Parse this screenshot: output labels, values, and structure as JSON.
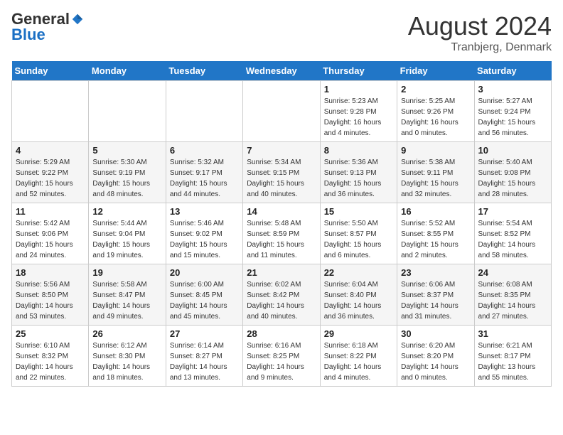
{
  "header": {
    "logo_general": "General",
    "logo_blue": "Blue",
    "month_year": "August 2024",
    "location": "Tranbjerg, Denmark"
  },
  "days_of_week": [
    "Sunday",
    "Monday",
    "Tuesday",
    "Wednesday",
    "Thursday",
    "Friday",
    "Saturday"
  ],
  "weeks": [
    [
      {
        "day": "",
        "info": ""
      },
      {
        "day": "",
        "info": ""
      },
      {
        "day": "",
        "info": ""
      },
      {
        "day": "",
        "info": ""
      },
      {
        "day": "1",
        "info": "Sunrise: 5:23 AM\nSunset: 9:28 PM\nDaylight: 16 hours\nand 4 minutes."
      },
      {
        "day": "2",
        "info": "Sunrise: 5:25 AM\nSunset: 9:26 PM\nDaylight: 16 hours\nand 0 minutes."
      },
      {
        "day": "3",
        "info": "Sunrise: 5:27 AM\nSunset: 9:24 PM\nDaylight: 15 hours\nand 56 minutes."
      }
    ],
    [
      {
        "day": "4",
        "info": "Sunrise: 5:29 AM\nSunset: 9:22 PM\nDaylight: 15 hours\nand 52 minutes."
      },
      {
        "day": "5",
        "info": "Sunrise: 5:30 AM\nSunset: 9:19 PM\nDaylight: 15 hours\nand 48 minutes."
      },
      {
        "day": "6",
        "info": "Sunrise: 5:32 AM\nSunset: 9:17 PM\nDaylight: 15 hours\nand 44 minutes."
      },
      {
        "day": "7",
        "info": "Sunrise: 5:34 AM\nSunset: 9:15 PM\nDaylight: 15 hours\nand 40 minutes."
      },
      {
        "day": "8",
        "info": "Sunrise: 5:36 AM\nSunset: 9:13 PM\nDaylight: 15 hours\nand 36 minutes."
      },
      {
        "day": "9",
        "info": "Sunrise: 5:38 AM\nSunset: 9:11 PM\nDaylight: 15 hours\nand 32 minutes."
      },
      {
        "day": "10",
        "info": "Sunrise: 5:40 AM\nSunset: 9:08 PM\nDaylight: 15 hours\nand 28 minutes."
      }
    ],
    [
      {
        "day": "11",
        "info": "Sunrise: 5:42 AM\nSunset: 9:06 PM\nDaylight: 15 hours\nand 24 minutes."
      },
      {
        "day": "12",
        "info": "Sunrise: 5:44 AM\nSunset: 9:04 PM\nDaylight: 15 hours\nand 19 minutes."
      },
      {
        "day": "13",
        "info": "Sunrise: 5:46 AM\nSunset: 9:02 PM\nDaylight: 15 hours\nand 15 minutes."
      },
      {
        "day": "14",
        "info": "Sunrise: 5:48 AM\nSunset: 8:59 PM\nDaylight: 15 hours\nand 11 minutes."
      },
      {
        "day": "15",
        "info": "Sunrise: 5:50 AM\nSunset: 8:57 PM\nDaylight: 15 hours\nand 6 minutes."
      },
      {
        "day": "16",
        "info": "Sunrise: 5:52 AM\nSunset: 8:55 PM\nDaylight: 15 hours\nand 2 minutes."
      },
      {
        "day": "17",
        "info": "Sunrise: 5:54 AM\nSunset: 8:52 PM\nDaylight: 14 hours\nand 58 minutes."
      }
    ],
    [
      {
        "day": "18",
        "info": "Sunrise: 5:56 AM\nSunset: 8:50 PM\nDaylight: 14 hours\nand 53 minutes."
      },
      {
        "day": "19",
        "info": "Sunrise: 5:58 AM\nSunset: 8:47 PM\nDaylight: 14 hours\nand 49 minutes."
      },
      {
        "day": "20",
        "info": "Sunrise: 6:00 AM\nSunset: 8:45 PM\nDaylight: 14 hours\nand 45 minutes."
      },
      {
        "day": "21",
        "info": "Sunrise: 6:02 AM\nSunset: 8:42 PM\nDaylight: 14 hours\nand 40 minutes."
      },
      {
        "day": "22",
        "info": "Sunrise: 6:04 AM\nSunset: 8:40 PM\nDaylight: 14 hours\nand 36 minutes."
      },
      {
        "day": "23",
        "info": "Sunrise: 6:06 AM\nSunset: 8:37 PM\nDaylight: 14 hours\nand 31 minutes."
      },
      {
        "day": "24",
        "info": "Sunrise: 6:08 AM\nSunset: 8:35 PM\nDaylight: 14 hours\nand 27 minutes."
      }
    ],
    [
      {
        "day": "25",
        "info": "Sunrise: 6:10 AM\nSunset: 8:32 PM\nDaylight: 14 hours\nand 22 minutes."
      },
      {
        "day": "26",
        "info": "Sunrise: 6:12 AM\nSunset: 8:30 PM\nDaylight: 14 hours\nand 18 minutes."
      },
      {
        "day": "27",
        "info": "Sunrise: 6:14 AM\nSunset: 8:27 PM\nDaylight: 14 hours\nand 13 minutes."
      },
      {
        "day": "28",
        "info": "Sunrise: 6:16 AM\nSunset: 8:25 PM\nDaylight: 14 hours\nand 9 minutes."
      },
      {
        "day": "29",
        "info": "Sunrise: 6:18 AM\nSunset: 8:22 PM\nDaylight: 14 hours\nand 4 minutes."
      },
      {
        "day": "30",
        "info": "Sunrise: 6:20 AM\nSunset: 8:20 PM\nDaylight: 14 hours\nand 0 minutes."
      },
      {
        "day": "31",
        "info": "Sunrise: 6:21 AM\nSunset: 8:17 PM\nDaylight: 13 hours\nand 55 minutes."
      }
    ]
  ]
}
